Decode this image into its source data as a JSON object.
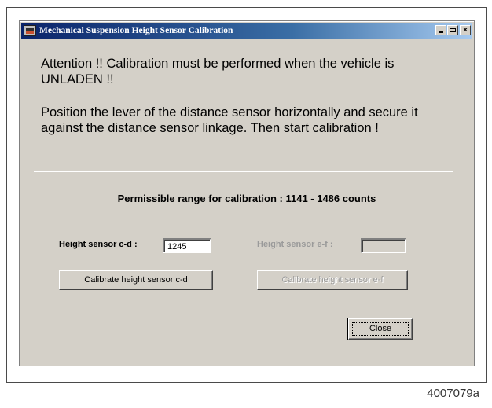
{
  "window": {
    "title": "Mechanical Suspension Height Sensor Calibration",
    "minimize_glyph": "_",
    "maximize_glyph": "□",
    "close_glyph": "×"
  },
  "message": {
    "attention": "Attention !!  Calibration must be performed when the vehicle is UNLADEN !!",
    "instruction": "Position the lever of the distance sensor horizontally and secure it against the distance sensor linkage.  Then start calibration !"
  },
  "range_text": "Permissible range for calibration : 1141 - 1486  counts",
  "sensor_cd": {
    "label": "Height sensor c-d :",
    "value": "1245",
    "button_label": "Calibrate height sensor c-d"
  },
  "sensor_ef": {
    "label": "Height sensor e-f :",
    "value": "",
    "button_label": "Calibrate height sensor e-f"
  },
  "close_button": {
    "label": "Close"
  },
  "figure_caption": "4007079a"
}
